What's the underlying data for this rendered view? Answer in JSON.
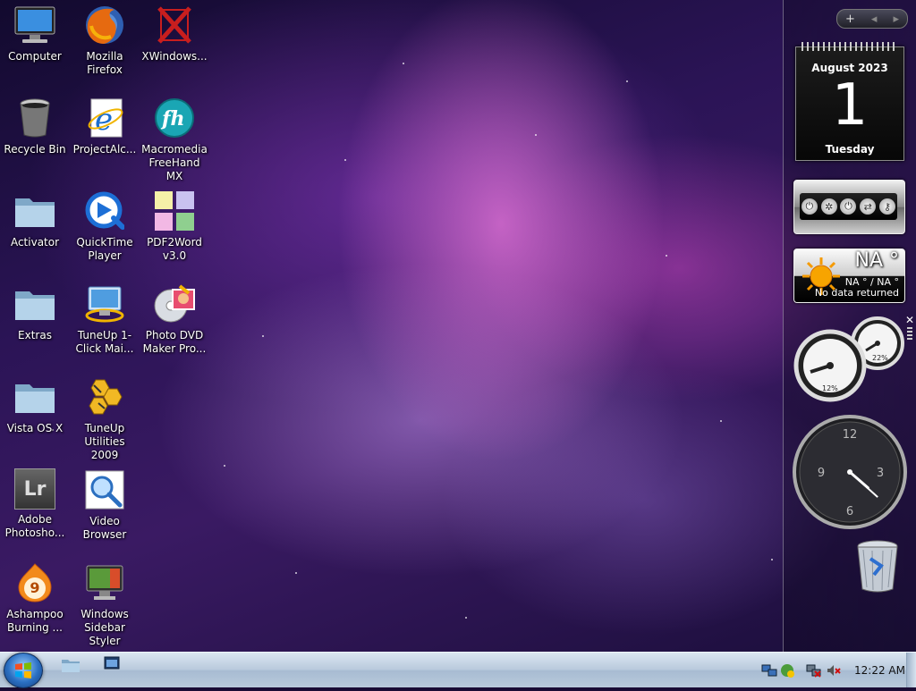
{
  "desktop": {
    "icons": [
      {
        "id": "computer",
        "label": "Computer",
        "icon": "computer-icon"
      },
      {
        "id": "firefox",
        "label": "Mozilla Firefox",
        "icon": "firefox-icon"
      },
      {
        "id": "xwindows",
        "label": "XWindows...",
        "icon": "xwindows-icon"
      },
      {
        "id": "recycle",
        "label": "Recycle Bin",
        "icon": "recycle-bin-icon"
      },
      {
        "id": "projectalc",
        "label": "ProjectAlc...",
        "icon": "internet-explorer-icon"
      },
      {
        "id": "freehand",
        "label": "Macromedia FreeHand MX",
        "icon": "freehand-icon"
      },
      {
        "id": "activator",
        "label": "Activator",
        "icon": "folder-icon"
      },
      {
        "id": "quicktime",
        "label": "QuickTime Player",
        "icon": "quicktime-icon"
      },
      {
        "id": "pdf2word",
        "label": "PDF2Word v3.0",
        "icon": "pdf2word-icon"
      },
      {
        "id": "extras",
        "label": "Extras",
        "icon": "folder-icon"
      },
      {
        "id": "tuneup1click",
        "label": "TuneUp 1-Click Mai...",
        "icon": "tuneup-1click-icon"
      },
      {
        "id": "photodvd",
        "label": "Photo DVD Maker Pro...",
        "icon": "photo-dvd-icon"
      },
      {
        "id": "vistaosx",
        "label": "Vista OS X",
        "icon": "folder-icon"
      },
      {
        "id": "tuneup2009",
        "label": "TuneUp Utilities 2009",
        "icon": "tuneup-utilities-icon"
      },
      {
        "id": "adobe",
        "label": "Adobe Photosho...",
        "icon": "lightroom-icon",
        "glyph_text": "Lr"
      },
      {
        "id": "videobrowser",
        "label": "Video Browser",
        "icon": "video-browser-icon"
      },
      {
        "id": "ashampoo",
        "label": "Ashampoo Burning ...",
        "icon": "ashampoo-icon",
        "glyph_text": "9"
      },
      {
        "id": "sidebarstyler",
        "label": "Windows Sidebar Styler",
        "icon": "sidebar-styler-icon"
      }
    ]
  },
  "sidebar": {
    "controls": {
      "add": "+",
      "prev": "◂",
      "next": "▸"
    },
    "calendar": {
      "month": "August 2023",
      "day": "1",
      "weekday": "Tuesday"
    },
    "shutdown": {
      "buttons": [
        "power-icon",
        "restart-icon",
        "standby-icon",
        "switch-user-icon",
        "lock-icon"
      ]
    },
    "weather": {
      "temp": "NA °",
      "range": "NA ° / NA °",
      "status": "No data returned"
    },
    "meter": {
      "cpu": "12%",
      "memory": "22%"
    },
    "clock": {
      "numerals": [
        "12",
        "3",
        "6",
        "9"
      ],
      "hour": 4,
      "minute": 22,
      "second": 0
    }
  },
  "taskbar": {
    "start_label": "Start",
    "time": "12:22 AM"
  },
  "colors": {
    "taskbar": "#b8c9dc",
    "desktop": "#2b1456",
    "accent": "#e870d8"
  }
}
